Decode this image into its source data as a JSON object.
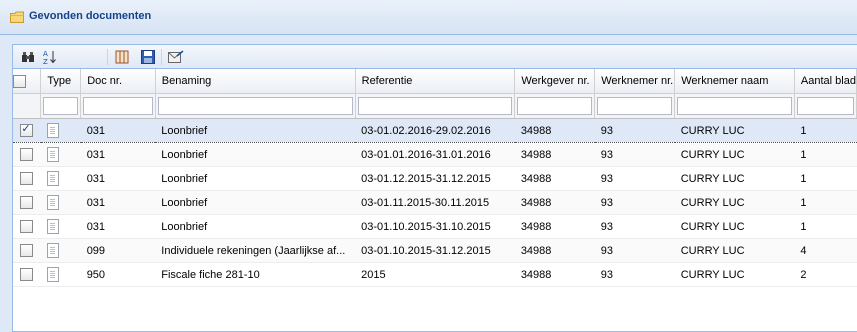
{
  "panel": {
    "title": "Gevonden documenten"
  },
  "toolbar": {
    "icons": [
      "binoculars-icon",
      "sort-az-icon",
      "columns-icon",
      "save-icon",
      "export-icon"
    ]
  },
  "columns": {
    "type": "Type",
    "docnr": "Doc nr.",
    "benaming": "Benaming",
    "referentie": "Referentie",
    "werkgever": "Werkgever nr.",
    "werknemer": "Werknemer nr.",
    "naam": "Werknemer naam",
    "aantal": "Aantal blad"
  },
  "rows": [
    {
      "checked": true,
      "docnr": "031",
      "benaming": "Loonbrief",
      "referentie": "03-01.02.2016-29.02.2016",
      "werkgever": "34988",
      "werknemer": "93",
      "naam": "CURRY LUC",
      "aantal": "1"
    },
    {
      "checked": false,
      "docnr": "031",
      "benaming": "Loonbrief",
      "referentie": "03-01.01.2016-31.01.2016",
      "werkgever": "34988",
      "werknemer": "93",
      "naam": "CURRY LUC",
      "aantal": "1"
    },
    {
      "checked": false,
      "docnr": "031",
      "benaming": "Loonbrief",
      "referentie": "03-01.12.2015-31.12.2015",
      "werkgever": "34988",
      "werknemer": "93",
      "naam": "CURRY LUC",
      "aantal": "1"
    },
    {
      "checked": false,
      "docnr": "031",
      "benaming": "Loonbrief",
      "referentie": "03-01.11.2015-30.11.2015",
      "werkgever": "34988",
      "werknemer": "93",
      "naam": "CURRY LUC",
      "aantal": "1"
    },
    {
      "checked": false,
      "docnr": "031",
      "benaming": "Loonbrief",
      "referentie": "03-01.10.2015-31.10.2015",
      "werkgever": "34988",
      "werknemer": "93",
      "naam": "CURRY LUC",
      "aantal": "1"
    },
    {
      "checked": false,
      "docnr": "099",
      "benaming": "Individuele rekeningen (Jaarlijkse af...",
      "referentie": "03-01.10.2015-31.12.2015",
      "werkgever": "34988",
      "werknemer": "93",
      "naam": "CURRY LUC",
      "aantal": "4"
    },
    {
      "checked": false,
      "docnr": "950",
      "benaming": "Fiscale fiche 281-10",
      "referentie": "2015",
      "werkgever": "34988",
      "werknemer": "93",
      "naam": "CURRY LUC",
      "aantal": "2"
    }
  ]
}
